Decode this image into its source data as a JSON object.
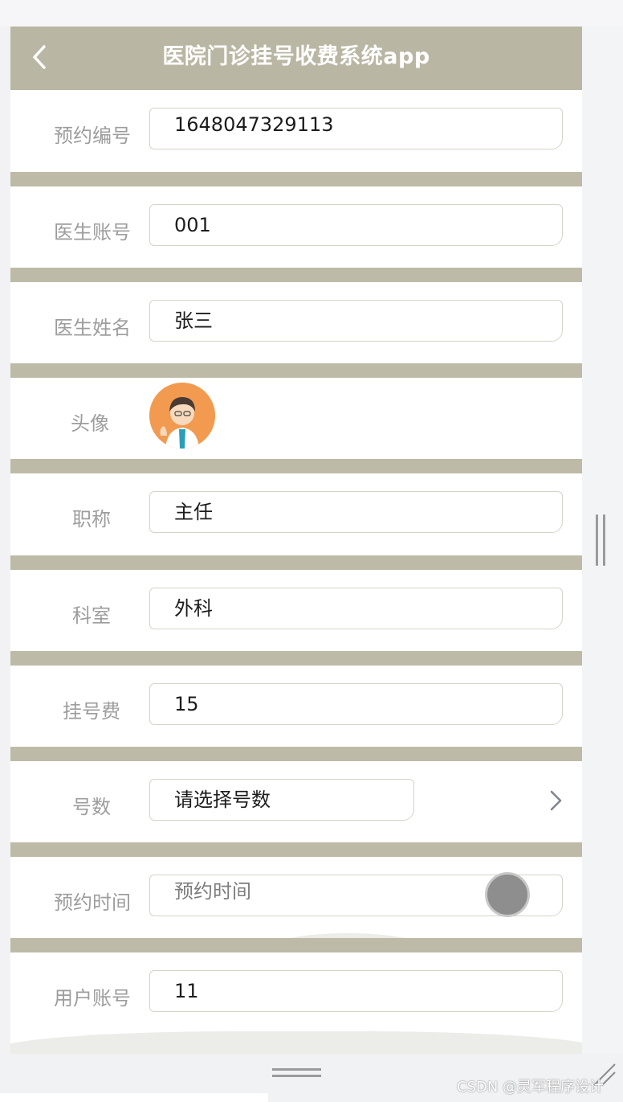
{
  "header": {
    "title": "医院门诊挂号收费系统app"
  },
  "form": {
    "appointment_no": {
      "label": "预约编号",
      "value": "1648047329113"
    },
    "doctor_account": {
      "label": "医生账号",
      "value": "001"
    },
    "doctor_name": {
      "label": "医生姓名",
      "value": "张三"
    },
    "avatar": {
      "label": "头像"
    },
    "title": {
      "label": "职称",
      "value": "主任"
    },
    "department": {
      "label": "科室",
      "value": "外科"
    },
    "fee": {
      "label": "挂号费",
      "value": "15"
    },
    "number": {
      "label": "号数",
      "placeholder": "请选择号数"
    },
    "appointment_time": {
      "label": "预约时间",
      "placeholder": "预约时间"
    },
    "user_account": {
      "label": "用户账号",
      "value": "11"
    }
  },
  "watermark": "CSDN @灵军程序设计",
  "colors": {
    "header": "#b9b7a3",
    "separator": "#bdbba7",
    "label": "#9d9d9d"
  },
  "icons": [
    "back-arrow-icon",
    "chevron-right-icon",
    "doctor-avatar",
    "resize-grip-icon"
  ]
}
